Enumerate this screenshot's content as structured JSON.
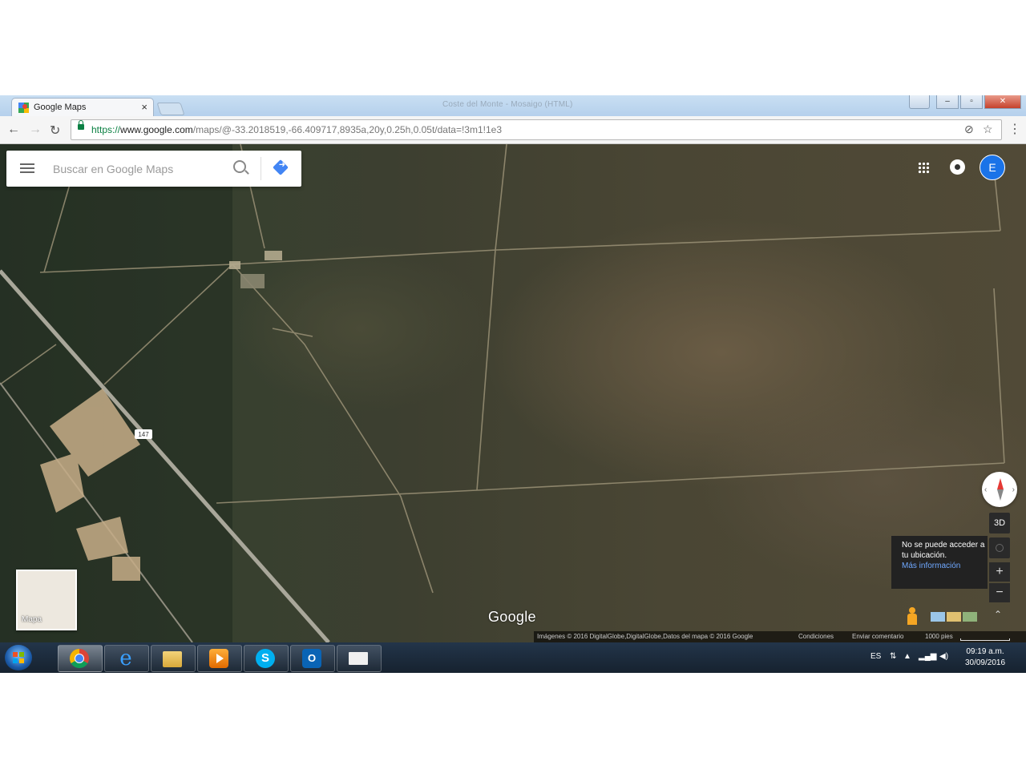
{
  "browser": {
    "tab_title": "Google Maps",
    "tab_close": "×",
    "window_title": "Coste del Monte - Mosaigo (HTML)",
    "url_scheme": "https://",
    "url_host": "www.google.com",
    "url_path": "/maps/@-33.2018519,-66.409717,8935a,20y,0.25h,0.05t/data=!3m1!1e3"
  },
  "map": {
    "search_placeholder": "Buscar en Google Maps",
    "account_initial": "E",
    "road_label": "147",
    "compass_left": "‹",
    "compass_right": "›",
    "btn_3d": "3D",
    "zoom_in": "+",
    "zoom_out": "−",
    "expand": "⌃",
    "tooltip_text": "No se puede acceder a tu ubicación.",
    "tooltip_link": "Más información",
    "thumbnail_label": "Mapa",
    "google_logo": "Google",
    "footer": {
      "imagery": "Imágenes © 2016 DigitalGlobe,DigitalGlobe,Datos del mapa © 2016 Google",
      "terms": "Condiciones",
      "feedback": "Enviar comentario",
      "scale": "1000 pies"
    }
  },
  "taskbar": {
    "apps": [
      "chrome",
      "internet-explorer",
      "file-explorer",
      "media-player",
      "skype",
      "outlook",
      "mail"
    ],
    "ie_glyph": "e",
    "skype_glyph": "S",
    "outlook_glyph": "O",
    "language": "ES",
    "time": "09:19 a.m.",
    "date": "30/09/2016"
  }
}
